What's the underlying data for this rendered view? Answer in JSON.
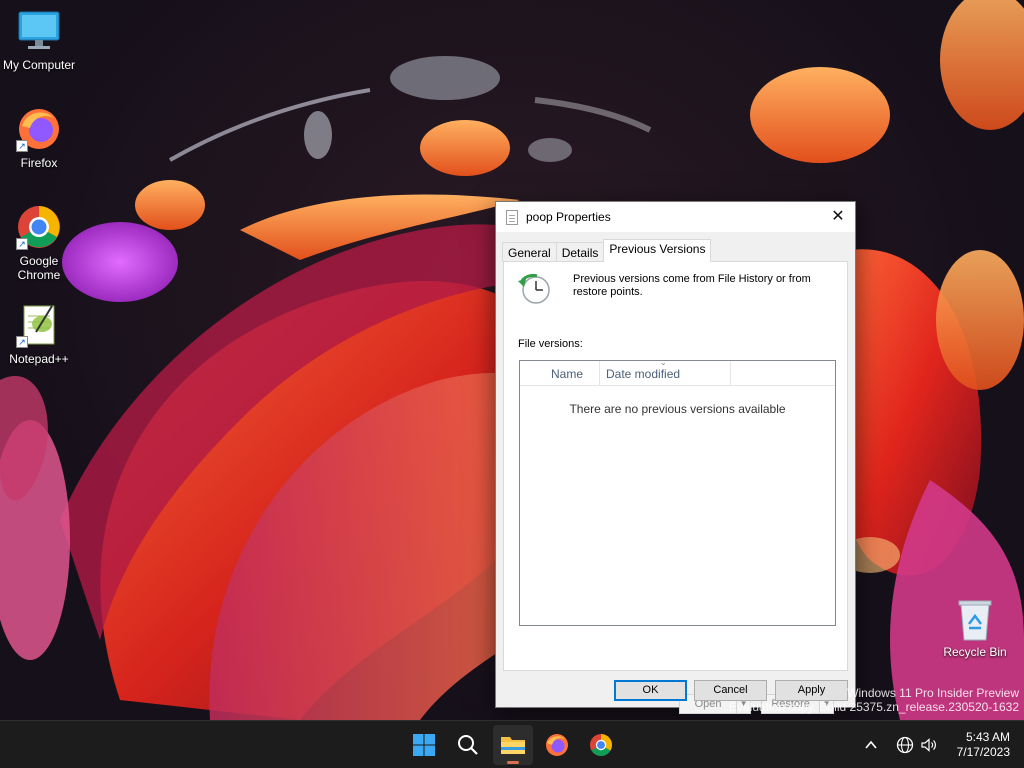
{
  "desktop": {
    "icons": [
      {
        "label": "My Computer"
      },
      {
        "label": "Firefox"
      },
      {
        "label": "Google Chrome"
      },
      {
        "label": "Notepad++"
      }
    ],
    "recycle_bin": "Recycle Bin",
    "watermark_line1": "Windows 11 Pro Insider Preview",
    "watermark_line2": "Evaluation copy. Build 25375.zn_release.230520-1632"
  },
  "dialog": {
    "title": "poop Properties",
    "close_glyph": "✕",
    "tabs": [
      {
        "label": "General"
      },
      {
        "label": "Details"
      },
      {
        "label": "Previous Versions",
        "active": true
      }
    ],
    "info_text": "Previous versions come from File History or from restore points.",
    "file_versions_label": "File versions:",
    "columns": {
      "name": "Name",
      "date": "Date modified"
    },
    "empty_message": "There are no previous versions available",
    "open_label": "Open",
    "restore_label": "Restore",
    "ok_label": "OK",
    "cancel_label": "Cancel",
    "apply_label": "Apply"
  },
  "taskbar": {
    "items": [
      "start-icon",
      "search-icon",
      "file-explorer-icon",
      "firefox-icon",
      "chrome-icon"
    ],
    "time": "5:43 AM",
    "date": "7/17/2023"
  },
  "colors": {
    "accent": "#0078d4",
    "taskbar": "#1c1c1c",
    "dialog_bg": "#f0f0f0"
  }
}
